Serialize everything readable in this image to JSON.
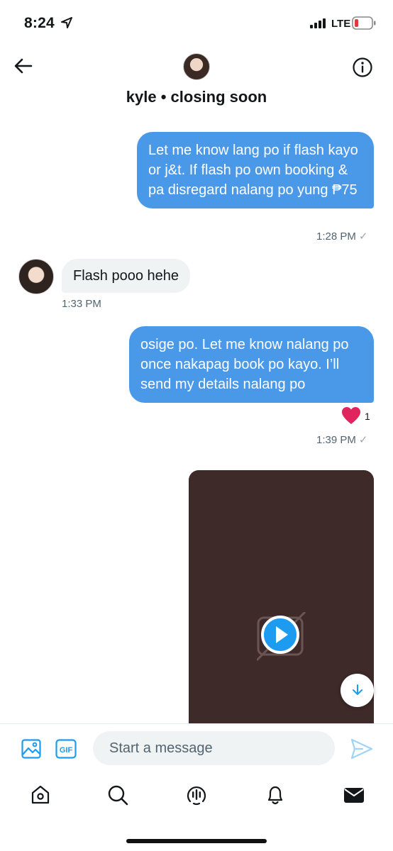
{
  "status_bar": {
    "time": "8:24",
    "network": "LTE",
    "battery_color": "#e0393e"
  },
  "header": {
    "title": "kyle • closing soon",
    "back_icon": "arrow-left-icon",
    "info_icon": "info-circle-icon"
  },
  "messages": [
    {
      "direction": "outgoing",
      "text": "Let me know lang po if flash kayo or j&t. If flash po own booking & pa disregard nalang po yung ₱75",
      "time": "1:28 PM",
      "check": "✓"
    },
    {
      "direction": "incoming",
      "text": "Flash pooo hehe",
      "time": "1:33 PM"
    },
    {
      "direction": "outgoing",
      "text": "osige po. Let me know nalang po once nakapag book po kayo. I’ll send my details nalang po",
      "time": "1:39 PM",
      "check": "✓",
      "reaction": {
        "icon": "heart-icon",
        "count": "1"
      }
    },
    {
      "direction": "outgoing",
      "type": "video",
      "background": "#3d2a29"
    }
  ],
  "composer": {
    "placeholder": "Start a message",
    "value": ""
  },
  "bottom_nav": [
    "home-icon",
    "search-icon",
    "spaces-icon",
    "notifications-icon",
    "messages-icon"
  ],
  "colors": {
    "accent": "#1d9bf0",
    "outgoing_bubble": "#4a99e9",
    "incoming_bubble": "#eff3f4",
    "heart": "#e0245e"
  }
}
